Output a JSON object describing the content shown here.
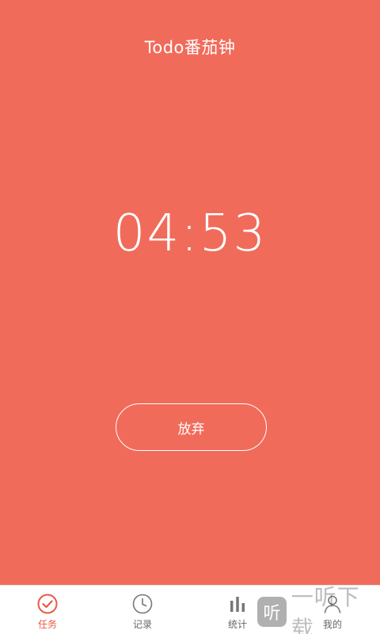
{
  "header": {
    "title": "Todo番茄钟"
  },
  "timer": {
    "display": "04:53"
  },
  "actions": {
    "give_up_label": "放弃"
  },
  "tabbar": {
    "items": [
      {
        "label": "任务",
        "icon": "check-circle-icon",
        "active": true
      },
      {
        "label": "记录",
        "icon": "clock-icon",
        "active": false
      },
      {
        "label": "统计",
        "icon": "bar-chart-icon",
        "active": false
      },
      {
        "label": "我的",
        "icon": "user-icon",
        "active": false
      }
    ]
  },
  "watermark": {
    "badge": "听",
    "text": "一听下载"
  },
  "colors": {
    "background": "#f16b5a",
    "accent": "#e85a46",
    "tab_inactive": "#666666"
  }
}
